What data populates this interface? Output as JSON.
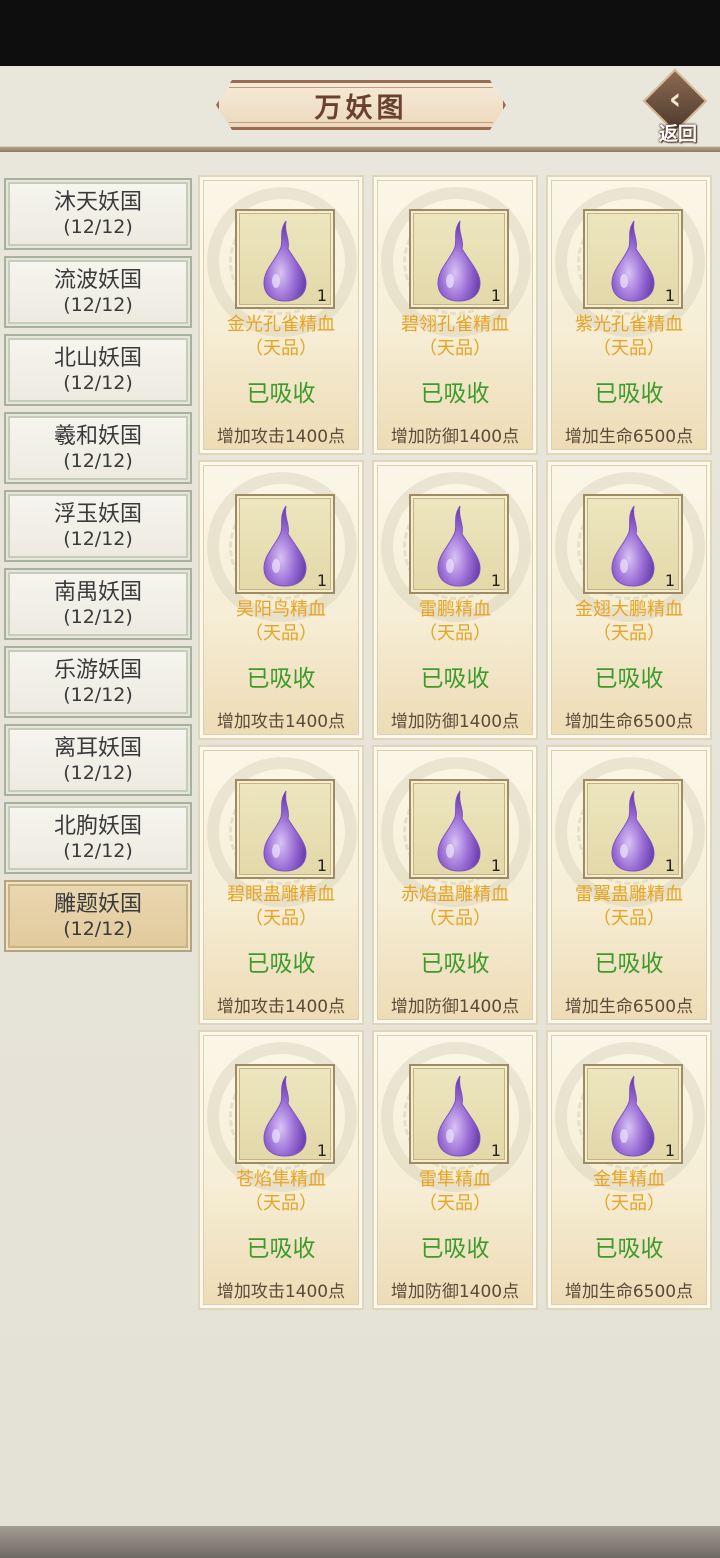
{
  "header": {
    "title": "万妖图",
    "back_label": "返回"
  },
  "sidebar": {
    "items": [
      {
        "name": "沐天妖国",
        "count": "(12/12)",
        "active": false
      },
      {
        "name": "流波妖国",
        "count": "(12/12)",
        "active": false
      },
      {
        "name": "北山妖国",
        "count": "(12/12)",
        "active": false
      },
      {
        "name": "羲和妖国",
        "count": "(12/12)",
        "active": false
      },
      {
        "name": "浮玉妖国",
        "count": "(12/12)",
        "active": false
      },
      {
        "name": "南禺妖国",
        "count": "(12/12)",
        "active": false
      },
      {
        "name": "乐游妖国",
        "count": "(12/12)",
        "active": false
      },
      {
        "name": "离耳妖国",
        "count": "(12/12)",
        "active": false
      },
      {
        "name": "北朐妖国",
        "count": "(12/12)",
        "active": false
      },
      {
        "name": "雕题妖国",
        "count": "(12/12)",
        "active": true
      }
    ]
  },
  "cards": [
    {
      "name": "金光孔雀精血",
      "grade": "（天品）",
      "qty": "1",
      "status": "已吸收",
      "bonus": "增加攻击1400点"
    },
    {
      "name": "碧翎孔雀精血",
      "grade": "（天品）",
      "qty": "1",
      "status": "已吸收",
      "bonus": "增加防御1400点"
    },
    {
      "name": "紫光孔雀精血",
      "grade": "（天品）",
      "qty": "1",
      "status": "已吸收",
      "bonus": "增加生命6500点"
    },
    {
      "name": "昊阳鸟精血",
      "grade": "（天品）",
      "qty": "1",
      "status": "已吸收",
      "bonus": "增加攻击1400点"
    },
    {
      "name": "雷鹏精血",
      "grade": "（天品）",
      "qty": "1",
      "status": "已吸收",
      "bonus": "增加防御1400点"
    },
    {
      "name": "金翅大鹏精血",
      "grade": "（天品）",
      "qty": "1",
      "status": "已吸收",
      "bonus": "增加生命6500点"
    },
    {
      "name": "碧眼蛊雕精血",
      "grade": "（天品）",
      "qty": "1",
      "status": "已吸收",
      "bonus": "增加攻击1400点"
    },
    {
      "name": "赤焰蛊雕精血",
      "grade": "（天品）",
      "qty": "1",
      "status": "已吸收",
      "bonus": "增加防御1400点"
    },
    {
      "name": "雷翼蛊雕精血",
      "grade": "（天品）",
      "qty": "1",
      "status": "已吸收",
      "bonus": "增加生命6500点"
    },
    {
      "name": "苍焰隼精血",
      "grade": "（天品）",
      "qty": "1",
      "status": "已吸收",
      "bonus": "增加攻击1400点"
    },
    {
      "name": "雷隼精血",
      "grade": "（天品）",
      "qty": "1",
      "status": "已吸收",
      "bonus": "增加防御1400点"
    },
    {
      "name": "金隼精血",
      "grade": "（天品）",
      "qty": "1",
      "status": "已吸收",
      "bonus": "增加生命6500点"
    }
  ],
  "colors": {
    "item_name": "#e7a424",
    "status_absorbed": "#3d9b2c",
    "active_tab": "#e1c99b",
    "essence_drop": "#9b6fd6"
  },
  "icons": {
    "essence": "purple-blood-drop-icon",
    "back": "back-arrow-icon"
  }
}
